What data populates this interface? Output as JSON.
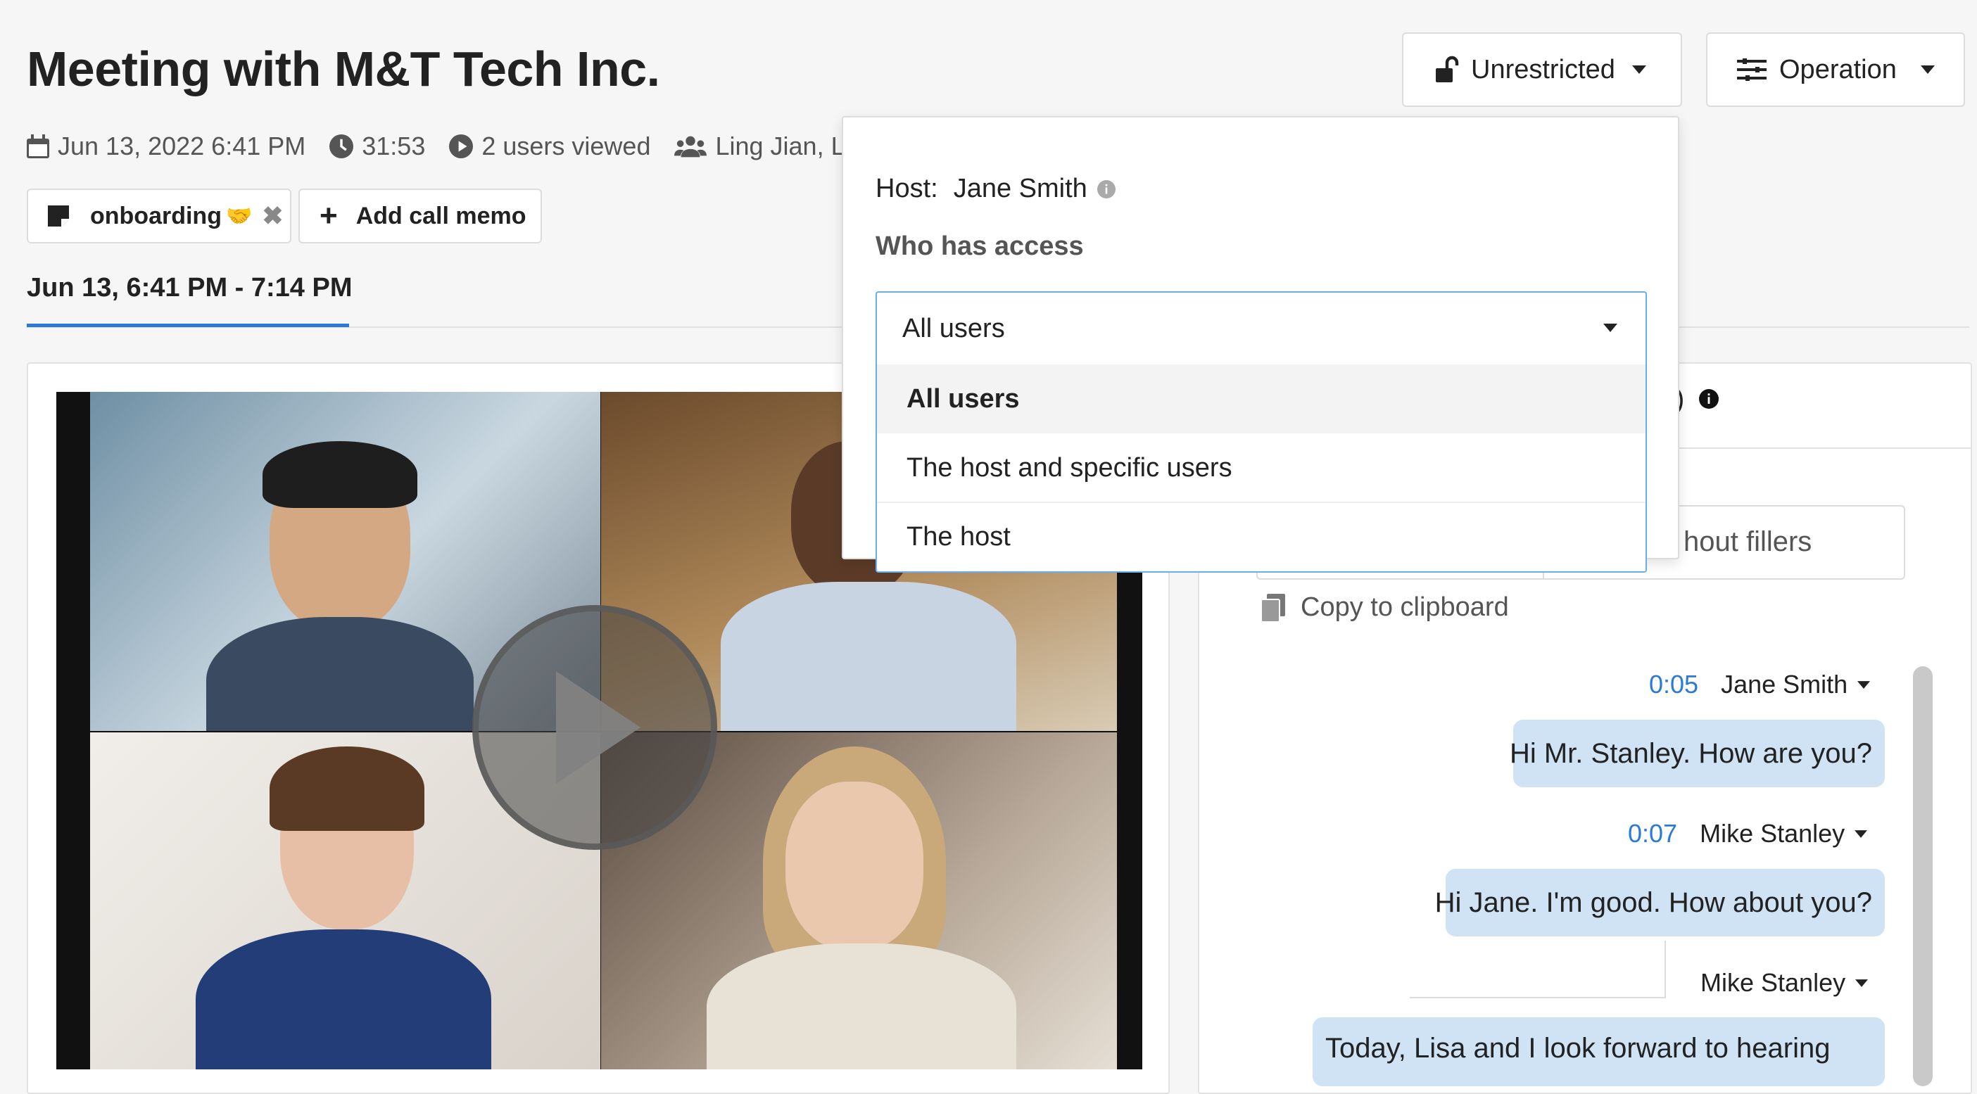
{
  "meeting": {
    "title": "Meeting with M&T Tech Inc.",
    "date": "Jun 13, 2022 6:41 PM",
    "duration": "31:53",
    "views": "2 users viewed",
    "participants": "Ling Jian, Lisa"
  },
  "header": {
    "access_button": "Unrestricted",
    "operation_button": "Operation"
  },
  "tags": {
    "tag_label": "onboarding",
    "tag_emoji": "🤝",
    "add_memo": "Add call memo"
  },
  "tabs": {
    "active": "Jun 13, 6:41 PM - 7:14 PM"
  },
  "access_popover": {
    "host_label": "Host:",
    "host_name": "Jane Smith",
    "who_has_access": "Who has access",
    "selected": "All users",
    "options": [
      "All users",
      "The host and specific users",
      "The host"
    ]
  },
  "transcript": {
    "partial_toggle": "hout fillers",
    "copy": "Copy to clipboard",
    "partial_tab_suffix": ")",
    "entries": [
      {
        "time": "0:05",
        "speaker": "Jane Smith",
        "text": "Hi Mr. Stanley. How are you?"
      },
      {
        "time": "0:07",
        "speaker": "Mike Stanley",
        "text": "Hi Jane. I'm good. How about you?"
      },
      {
        "time": "",
        "speaker": "Mike Stanley",
        "text": "Today, Lisa and I look forward to hearing"
      }
    ]
  },
  "colors": {
    "accent": "#2b7bd6",
    "bubble": "#cfe3f5"
  }
}
